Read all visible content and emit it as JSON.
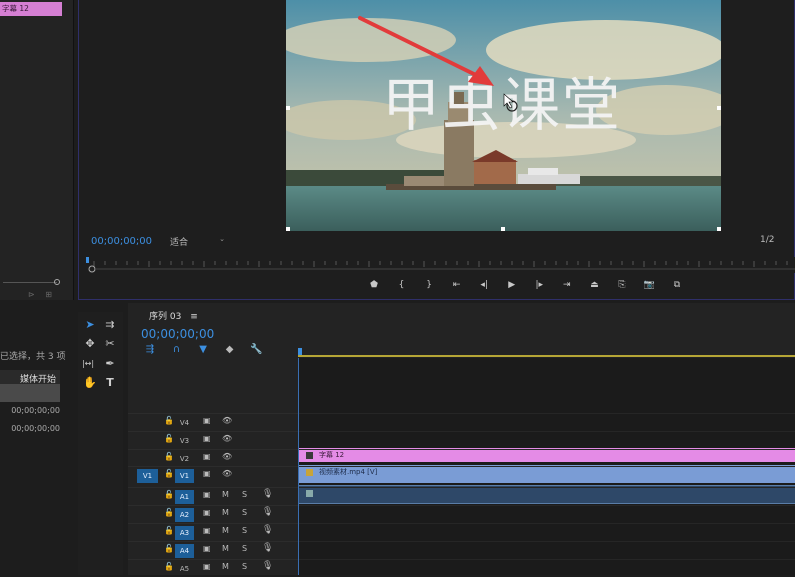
{
  "project_panel": {
    "clip_label": "字幕 12",
    "selection_text": "已选择，共 3 项",
    "column_header": "媒体开始",
    "rows": [
      "00;00;00;00",
      "00;00;00;00"
    ]
  },
  "program_monitor": {
    "overlay_title": "甲虫课堂",
    "timecode": "00;00;00;00",
    "fit_label": "适合",
    "resolution_label": "1/2",
    "transport_icons": [
      "marker-icon",
      "mark-in-icon",
      "mark-out-icon",
      "go-to-in-icon",
      "step-back-icon",
      "play-icon",
      "step-forward-icon",
      "go-to-out-icon",
      "lift-icon",
      "extract-icon",
      "export-frame-icon",
      "comparison-view-icon"
    ],
    "transport_glyphs": [
      "⬟",
      "{",
      "}",
      "⇤",
      "◂|",
      "▶",
      "|▸",
      "⇥",
      "⏏",
      "⎘",
      "📷",
      "⧉"
    ]
  },
  "timeline": {
    "sequence_name": "序列 03",
    "menu_glyph": "≡",
    "timecode": "00;00;00;00",
    "tool_glyphs": [
      "⇶",
      "∩",
      "▼",
      "◆",
      "🔧"
    ],
    "video_tracks": [
      {
        "label": "V4",
        "source": ""
      },
      {
        "label": "V3",
        "source": ""
      },
      {
        "label": "V2",
        "source": ""
      },
      {
        "label": "V1",
        "source": "V1"
      }
    ],
    "audio_tracks": [
      {
        "label": "A1",
        "mute": "M",
        "solo": "S"
      },
      {
        "label": "A2",
        "mute": "M",
        "solo": "S"
      },
      {
        "label": "A3",
        "mute": "M",
        "solo": "S"
      },
      {
        "label": "A4",
        "mute": "M",
        "solo": "S"
      },
      {
        "label": "A5",
        "mute": "M",
        "solo": "S"
      }
    ],
    "clips": {
      "title_clip": "字幕 12",
      "video_clip": "视频素材.mp4 [V]"
    }
  },
  "tools_panel": {
    "tools": [
      "selection-tool",
      "track-select-tool",
      "ripple-edit-tool",
      "razor-tool",
      "slip-tool",
      "pen-tool",
      "hand-tool",
      "type-tool"
    ],
    "glyphs": [
      "➤",
      "⇉",
      "✥",
      "✂",
      "|↔|",
      "✒",
      "✋",
      "T"
    ]
  },
  "colors": {
    "accent_blue": "#3c8fe0",
    "title_clip": "#e48be6",
    "video_clip": "#7a9cd5",
    "annotation_arrow": "#e23b3b"
  }
}
